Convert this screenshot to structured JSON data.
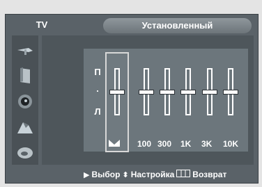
{
  "header": {
    "source_label": "TV",
    "title": "Установленный"
  },
  "sidebar": {
    "items": [
      {
        "icon": "antenna-icon"
      },
      {
        "icon": "picture-icon"
      },
      {
        "icon": "sound-icon"
      },
      {
        "icon": "channel-icon"
      },
      {
        "icon": "setup-icon"
      }
    ]
  },
  "equalizer": {
    "balance": {
      "top_label": "П",
      "mid_label": ".",
      "bottom_label": "Л",
      "level": 0.5,
      "icon": "balance-icon"
    },
    "bands": [
      {
        "label": "100",
        "level": 0.5
      },
      {
        "label": "300",
        "level": 0.5
      },
      {
        "label": "1K",
        "level": 0.5
      },
      {
        "label": "3K",
        "level": 0.5
      },
      {
        "label": "10K",
        "level": 0.5
      }
    ]
  },
  "hints": {
    "select": "Выбор",
    "adjust": "Настройка",
    "return": "Возврат"
  }
}
